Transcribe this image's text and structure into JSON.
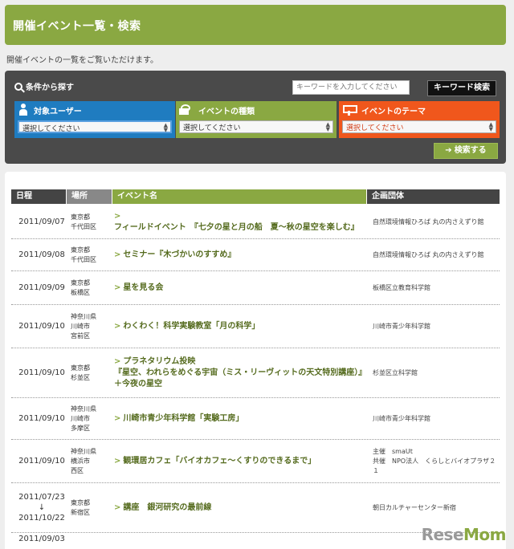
{
  "page": {
    "title": "開催イベント一覧・検索",
    "intro": "開催イベントの一覧をご覧いただけます。"
  },
  "search": {
    "condition_label": "条件から探す",
    "keyword_placeholder": "キーワードを入力してください",
    "keyword_button": "キーワード検索",
    "filters": [
      {
        "label": "対象ユーザー",
        "selected": "選択してください",
        "icon": "person-icon",
        "color": "#1f7cc0"
      },
      {
        "label": "イベントの種類",
        "selected": "選択してください",
        "icon": "camera-icon",
        "color": "#8aa842"
      },
      {
        "label": "イベントのテーマ",
        "selected": "選択してください",
        "icon": "signboard-icon",
        "color": "#f0571c"
      }
    ],
    "search_button": "検索する"
  },
  "table": {
    "headers": {
      "date": "日程",
      "place": "場所",
      "event": "イベント名",
      "org": "企画団体"
    },
    "rows": [
      {
        "date": "2011/09/07",
        "place": "東京都\n千代田区",
        "event": "フィールドイベント　『七夕の星と月の船　夏～秋の星空を楽しむ』",
        "org": "自然環境情報ひろば 丸の内さえずり館"
      },
      {
        "date": "2011/09/08",
        "place": "東京都\n千代田区",
        "event": "セミナー『木づかいのすすめ』",
        "org": "自然環境情報ひろば 丸の内さえずり館"
      },
      {
        "date": "2011/09/09",
        "place": "東京都\n板橋区",
        "event": "星を見る会",
        "org": "板橋区立教育科学館"
      },
      {
        "date": "2011/09/10",
        "place": "神奈川県\n川崎市\n宮前区",
        "event": "わくわく！科学実験教室「月の科学」",
        "org": "川崎市青少年科学館"
      },
      {
        "date": "2011/09/10",
        "place": "東京都\n杉並区",
        "event": "プラネタリウム投映\n『星空、われらをめぐる宇宙（ミス・リーヴィットの天文特別講座）』＋今夜の星空",
        "org": "杉並区立科学館"
      },
      {
        "date": "2011/09/10",
        "place": "神奈川県\n川崎市\n多摩区",
        "event": "川崎市青少年科学館「実験工房」",
        "org": "川崎市青少年科学館"
      },
      {
        "date": "2011/09/10",
        "place": "神奈川県\n横浜市\n西区",
        "event": "観環居カフェ「バイオカフェ～くすりのできるまで」",
        "org": "主催　smaUt\n共催　NPO法人　くらしとバイオプラザ２１"
      },
      {
        "date_start": "2011/07/23",
        "date_sep": "↓",
        "date_end": "2011/10/22",
        "place": "東京都\n新宿区",
        "event": "講座　銀河研究の最前線",
        "org": "朝日カルチャーセンター新宿"
      },
      {
        "date": "2011/09/03",
        "place": "",
        "event": "",
        "org": ""
      }
    ]
  },
  "watermark": {
    "part1": "Rese",
    "part2": "Mom"
  }
}
